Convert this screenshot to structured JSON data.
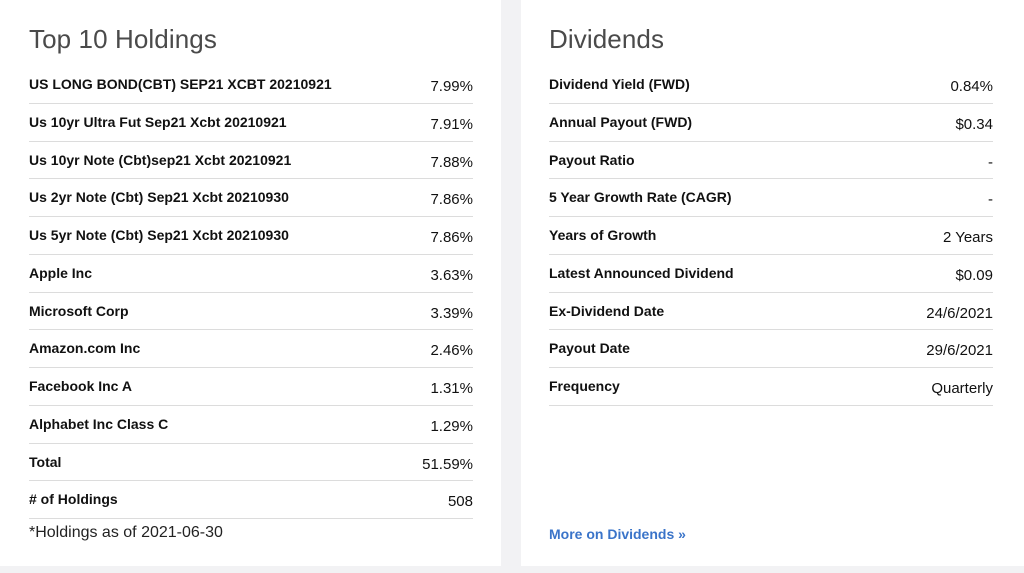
{
  "holdings": {
    "title": "Top 10 Holdings",
    "rows": [
      {
        "label": "US LONG BOND(CBT) SEP21 XCBT 20210921",
        "value": "7.99%"
      },
      {
        "label": "Us 10yr Ultra Fut Sep21 Xcbt 20210921",
        "value": "7.91%"
      },
      {
        "label": "Us 10yr Note (Cbt)sep21 Xcbt 20210921",
        "value": "7.88%"
      },
      {
        "label": "Us 2yr Note (Cbt) Sep21 Xcbt 20210930",
        "value": "7.86%"
      },
      {
        "label": "Us 5yr Note (Cbt) Sep21 Xcbt 20210930",
        "value": "7.86%"
      },
      {
        "label": "Apple Inc",
        "value": "3.63%"
      },
      {
        "label": "Microsoft Corp",
        "value": "3.39%"
      },
      {
        "label": "Amazon.com Inc",
        "value": "2.46%"
      },
      {
        "label": "Facebook Inc A",
        "value": "1.31%"
      },
      {
        "label": "Alphabet Inc Class C",
        "value": "1.29%"
      },
      {
        "label": "Total",
        "value": "51.59%"
      },
      {
        "label": "# of Holdings",
        "value": "508"
      }
    ],
    "footnote": "*Holdings as of 2021-06-30"
  },
  "dividends": {
    "title": "Dividends",
    "rows": [
      {
        "label": "Dividend Yield (FWD)",
        "value": "0.84%"
      },
      {
        "label": "Annual Payout (FWD)",
        "value": "$0.34"
      },
      {
        "label": "Payout Ratio",
        "value": "-"
      },
      {
        "label": "5 Year Growth Rate (CAGR)",
        "value": "-"
      },
      {
        "label": "Years of Growth",
        "value": "2 Years"
      },
      {
        "label": "Latest Announced Dividend",
        "value": "$0.09"
      },
      {
        "label": "Ex-Dividend Date",
        "value": "24/6/2021"
      },
      {
        "label": "Payout Date",
        "value": "29/6/2021"
      },
      {
        "label": "Frequency",
        "value": "Quarterly"
      }
    ],
    "more_link": "More on Dividends »"
  }
}
